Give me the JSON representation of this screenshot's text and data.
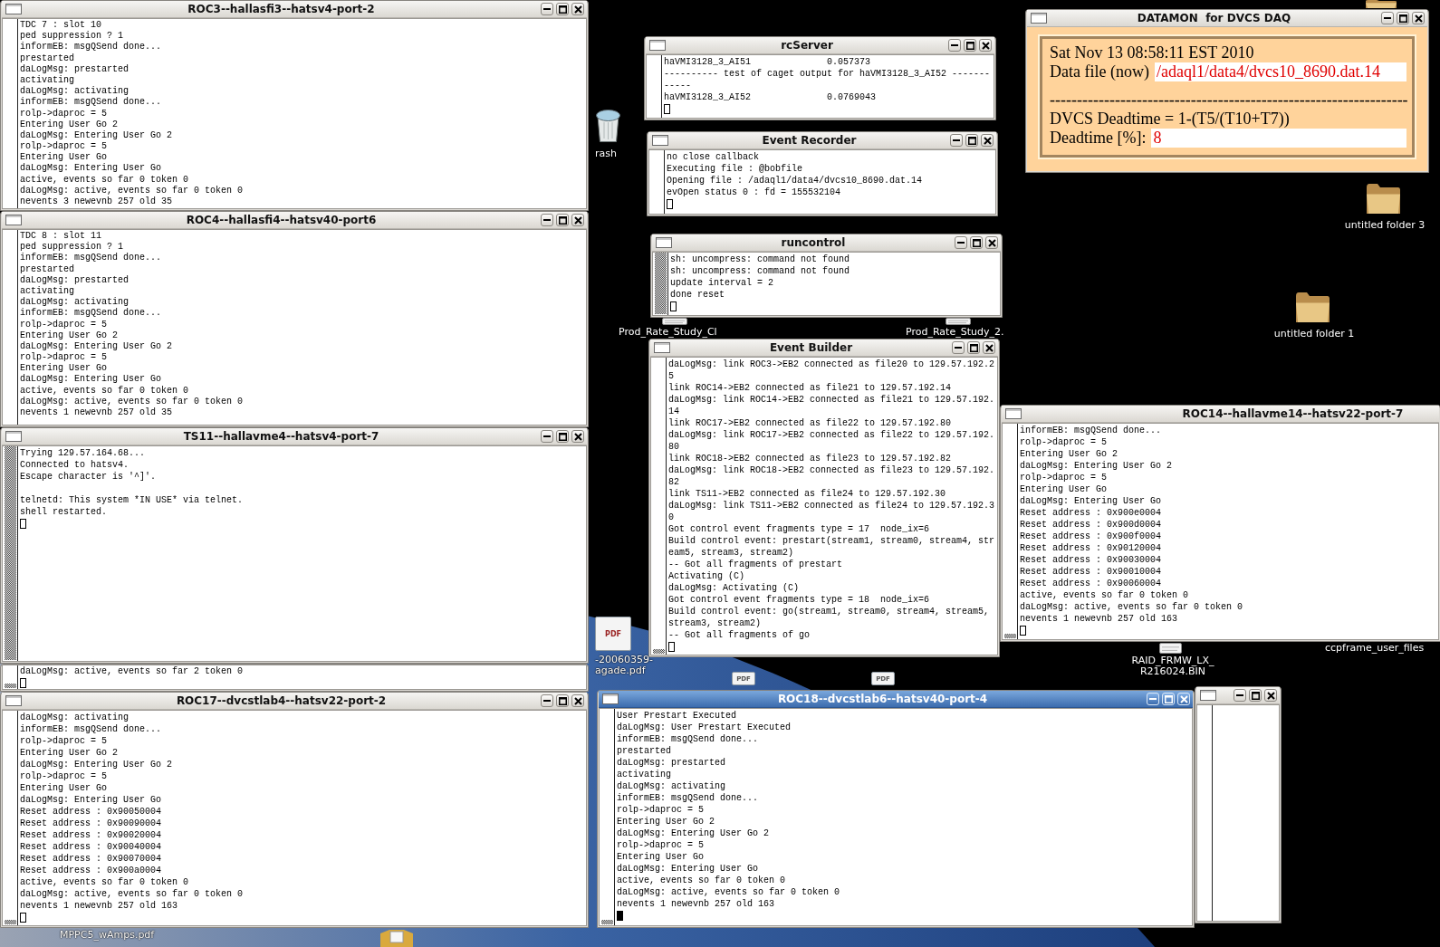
{
  "desktop_icons": [
    {
      "kind": "folder"
    },
    {
      "kind": "trash",
      "label": [
        "rash"
      ]
    },
    {
      "kind": "folder",
      "label": [
        "untitled folder 3"
      ]
    },
    {
      "kind": "file",
      "label": [
        "Prod_Rate_Study_Cl"
      ]
    },
    {
      "kind": "file",
      "label": [
        "Prod_Rate_Study_2."
      ]
    },
    {
      "kind": "folder",
      "label": [
        "untitled folder 1"
      ]
    },
    {
      "kind": "pdf",
      "badge": "PDF",
      "label": [
        "-20060359-",
        "agade.pdf"
      ]
    },
    {
      "kind": "pdf",
      "badge": "PDF"
    },
    {
      "kind": "pdf",
      "badge": "PDF"
    },
    {
      "kind": "file",
      "label": [
        "RAID_FRMW_LX_",
        "R216024.BIN"
      ]
    },
    {
      "kind": "none",
      "label": [
        "ccpframe_user_files"
      ]
    },
    {
      "kind": "none",
      "label": [
        "MPPC5_wAmps.pdf"
      ]
    },
    {
      "kind": "package"
    }
  ],
  "windows": [
    {
      "kind": "terminal",
      "title": "ROC3--hallasfi3--hatsv4-port-2",
      "active": false,
      "blocks": [
        [
          "TDC 7 : slot 10",
          "ped suppression ? 1",
          "informEB: msgQSend done...",
          "prestarted",
          "daLogMsg: prestarted",
          "activating",
          "daLogMsg: activating",
          "informEB: msgQSend done...",
          "rolp->daproc = 5",
          "Entering User Go 2",
          "daLogMsg: Entering User Go 2",
          "rolp->daproc = 5",
          "Entering User Go",
          "daLogMsg: Entering User Go",
          "active, events so far 0 token 0",
          "daLogMsg: active, events so far 0 token 0",
          "nevents 3 newevnb 257 old 35"
        ]
      ]
    },
    {
      "kind": "terminal",
      "title": "ROC4--hallasfi4--hatsv40-port6",
      "active": false,
      "blocks": [
        [
          "TDC 8 : slot 11",
          "ped suppression ? 1",
          "informEB: msgQSend done...",
          "prestarted",
          "daLogMsg: prestarted",
          "activating",
          "daLogMsg: activating",
          "informEB: msgQSend done...",
          "rolp->daproc = 5",
          "Entering User Go 2",
          "daLogMsg: Entering User Go 2",
          "rolp->daproc = 5",
          "Entering User Go",
          "daLogMsg: Entering User Go",
          "active, events so far 0 token 0",
          "daLogMsg: active, events so far 0 token 0",
          "nevents 1 newevnb 257 old 35"
        ]
      ]
    },
    {
      "kind": "terminal",
      "title": "TS11--hallavme4--hatsv4-port-7",
      "active": false,
      "blocks": [
        [
          "Trying 129.57.164.68...",
          "Connected to hatsv4.",
          "Escape character is '^]'."
        ],
        [
          "telnetd: This system *IN USE* via telnet.",
          "shell restarted."
        ]
      ]
    },
    {
      "kind": "terminal",
      "active": false,
      "blocks": [
        [
          "daLogMsg: active, events so far 2 token 0"
        ]
      ]
    },
    {
      "kind": "terminal",
      "title": "ROC17--dvcstlab4--hatsv22-port-2",
      "active": false,
      "blocks": [
        [
          "daLogMsg: activating",
          "informEB: msgQSend done...",
          "rolp->daproc = 5",
          "Entering User Go 2",
          "daLogMsg: Entering User Go 2",
          "rolp->daproc = 5",
          "Entering User Go",
          "daLogMsg: Entering User Go",
          "Reset address : 0x90050004",
          "Reset address : 0x90090004",
          "Reset address : 0x90020004",
          "Reset address : 0x90040004",
          "Reset address : 0x90070004",
          "Reset address : 0x900a0004",
          "active, events so far 0 token 0",
          "daLogMsg: active, events so far 0 token 0",
          "nevents 1 newevnb 257 old 163"
        ]
      ]
    },
    {
      "kind": "terminal",
      "title": "rcServer",
      "active": false,
      "blocks": [
        [
          "haVMI3128_3_AI51              0.057373",
          "---------- test of caget output for haVMI3128_3_AI52 -------",
          "-----",
          "haVMI3128_3_AI52              0.0769043"
        ]
      ]
    },
    {
      "kind": "terminal",
      "title": "Event Recorder",
      "active": false,
      "blocks": [
        [
          "no close callback",
          "Executing file : @bobfile",
          "Opening file : /adaql1/data4/dvcs10_8690.dat.14",
          "evOpen status 0 : fd = 155532104"
        ]
      ]
    },
    {
      "kind": "terminal",
      "title": "runcontrol",
      "active": false,
      "blocks": [
        [
          "sh: uncompress: command not found",
          "sh: uncompress: command not found",
          "update interval = 2",
          "done reset"
        ]
      ]
    },
    {
      "kind": "terminal",
      "title": "Event Builder",
      "active": false,
      "blocks": [
        [
          "daLogMsg: link ROC3->EB2 connected as file20 to 129.57.192.2",
          "5",
          "link ROC14->EB2 connected as file21 to 129.57.192.14",
          "daLogMsg: link ROC14->EB2 connected as file21 to 129.57.192.",
          "14",
          "link ROC17->EB2 connected as file22 to 129.57.192.80",
          "daLogMsg: link ROC17->EB2 connected as file22 to 129.57.192.",
          "80",
          "link ROC18->EB2 connected as file23 to 129.57.192.82",
          "daLogMsg: link ROC18->EB2 connected as file23 to 129.57.192.",
          "82",
          "link TS11->EB2 connected as file24 to 129.57.192.30",
          "daLogMsg: link TS11->EB2 connected as file24 to 129.57.192.3",
          "0",
          "Got control event fragments type = 17  node_ix=6",
          "Build control event: prestart(stream1, stream0, stream4, str",
          "eam5, stream3, stream2)",
          "-- Got all fragments of prestart",
          "Activating (C)",
          "daLogMsg: Activating (C)",
          "Got control event fragments type = 18  node_ix=6",
          "Build control event: go(stream1, stream0, stream4, stream5,",
          "stream3, stream2)",
          "-- Got all fragments of go"
        ]
      ]
    },
    {
      "kind": "monitor",
      "title": "DATAMON  for DVCS DAQ",
      "active": false,
      "datetime": "Sat Nov 13 08:58:11 EST 2010",
      "file_label": "Data file (now)",
      "file_value": "/adaql1/data4/dvcs10_8690.dat.14",
      "separator": "------------------------------------------------------------------",
      "formula": "DVCS Deadtime = 1-(T5/(T10+T7))",
      "deadtime_label": "Deadtime [%]:",
      "deadtime_value": "8"
    },
    {
      "kind": "terminal",
      "title": "ROC14--hallavme14--hatsv22-port-7",
      "active": false,
      "blocks": [
        [
          "informEB: msgQSend done...",
          "rolp->daproc = 5",
          "Entering User Go 2",
          "daLogMsg: Entering User Go 2",
          "rolp->daproc = 5",
          "Entering User Go",
          "daLogMsg: Entering User Go",
          "Reset address : 0x900e0004",
          "Reset address : 0x900d0004",
          "Reset address : 0x900f0004",
          "Reset address : 0x90120004",
          "Reset address : 0x90030004",
          "Reset address : 0x90010004",
          "Reset address : 0x90060004",
          "active, events so far 0 token 0",
          "daLogMsg: active, events so far 0 token 0",
          "nevents 1 newevnb 257 old 163"
        ]
      ]
    },
    {
      "kind": "terminal",
      "active": false
    },
    {
      "kind": "terminal",
      "title": "ROC18--dvcstlab6--hatsv40-port-4",
      "active": true,
      "blocks": [
        [
          "User Prestart Executed",
          "daLogMsg: User Prestart Executed",
          "informEB: msgQSend done...",
          "prestarted",
          "daLogMsg: prestarted",
          "activating",
          "daLogMsg: activating",
          "informEB: msgQSend done...",
          "rolp->daproc = 5",
          "Entering User Go 2",
          "daLogMsg: Entering User Go 2",
          "rolp->daproc = 5",
          "Entering User Go",
          "daLogMsg: Entering User Go",
          "active, events so far 0 token 0",
          "daLogMsg: active, events so far 0 token 0",
          "nevents 1 newevnb 257 old 163"
        ]
      ]
    }
  ]
}
